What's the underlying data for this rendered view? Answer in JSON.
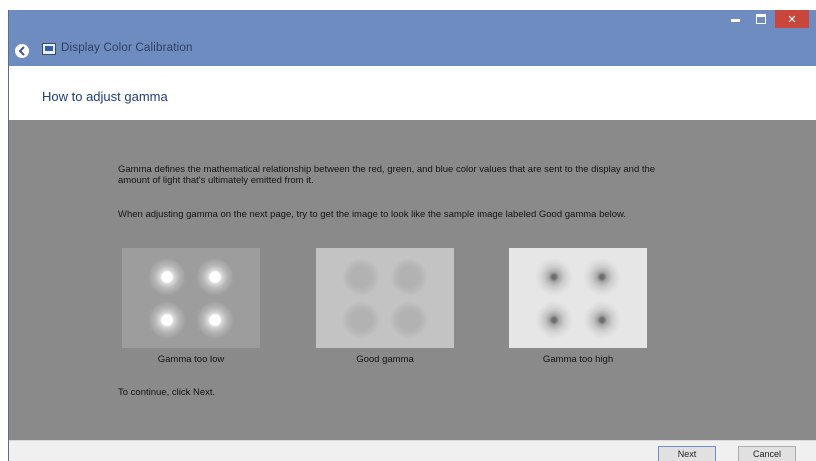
{
  "window": {
    "title": "Display Color Calibration",
    "controls": {
      "minimize_icon": "minimize-icon",
      "maximize_icon": "maximize-icon",
      "close_icon": "close-icon",
      "close_glyph": "✕"
    },
    "back_icon": "back-arrow-icon",
    "app_icon": "display-calibration-icon"
  },
  "header": {
    "heading": "How to adjust gamma"
  },
  "content": {
    "paragraph1": "Gamma defines the mathematical relationship between the red, green, and blue color values that are sent to the display and the amount of light that's ultimately emitted from it.",
    "paragraph2": "When adjusting gamma on the next page, try to get the image to look like the sample image labeled Good gamma below.",
    "samples": [
      {
        "caption": "Gamma too low"
      },
      {
        "caption": "Good gamma"
      },
      {
        "caption": "Gamma too high"
      }
    ],
    "continue_text": "To continue, click Next."
  },
  "footer": {
    "next_label": "Next",
    "cancel_label": "Cancel"
  },
  "colors": {
    "titlebar": "#6e8cc0",
    "close_button": "#c9463d",
    "content_background": "#8a8a8a",
    "heading_text": "#1f3d7a"
  }
}
